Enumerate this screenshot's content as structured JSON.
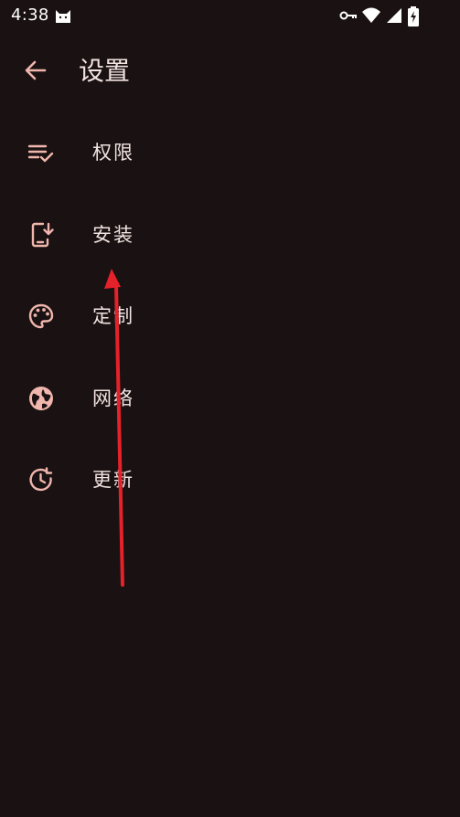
{
  "status_bar": {
    "time": "4:38",
    "left_icon": "cat-icon",
    "right_icons": [
      "vpn-key-icon",
      "wifi-icon",
      "cell-signal-icon",
      "battery-charging-icon"
    ]
  },
  "header": {
    "back_icon": "arrow-back-icon",
    "title": "设置"
  },
  "settings": {
    "items": [
      {
        "label": "权限",
        "icon": "playlist-check-icon"
      },
      {
        "label": "安装",
        "icon": "install-mobile-icon"
      },
      {
        "label": "定制",
        "icon": "palette-icon"
      },
      {
        "label": "网络",
        "icon": "globe-icon"
      },
      {
        "label": "更新",
        "icon": "update-icon"
      }
    ]
  },
  "colors": {
    "background": "#1a1212",
    "icon_tint": "#f0b6ad",
    "text": "#f2e4e2",
    "annotation": "#e5212a"
  }
}
